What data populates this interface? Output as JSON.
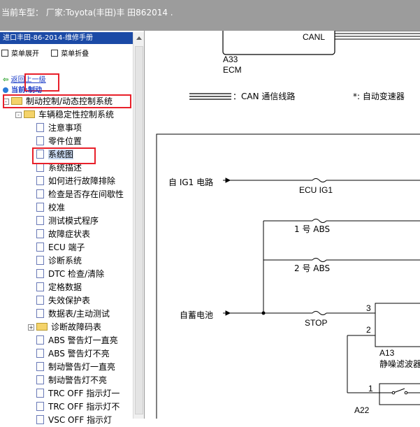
{
  "title": "当前车型： 厂家:Toyota(丰田)丰 田862014 .",
  "left_panel": {
    "header": "进口丰田-86-2014-维修手册",
    "expand_all": "菜单展开",
    "collapse_all": "菜单折叠",
    "back": "返回上一级",
    "current": "当前:制动",
    "tree": [
      {
        "label": "制动控制/动态控制系统",
        "level": 0,
        "kind": "folder",
        "pm": "-"
      },
      {
        "label": "车辆稳定性控制系统",
        "level": 1,
        "kind": "folder",
        "pm": "-"
      },
      {
        "label": "注意事项",
        "level": 2,
        "kind": "doc"
      },
      {
        "label": "零件位置",
        "level": 2,
        "kind": "doc"
      },
      {
        "label": "系统图",
        "level": 2,
        "kind": "doc"
      },
      {
        "label": "系统描述",
        "level": 2,
        "kind": "doc"
      },
      {
        "label": "如何进行故障排除",
        "level": 2,
        "kind": "doc"
      },
      {
        "label": "检查是否存在间歇性",
        "level": 2,
        "kind": "doc"
      },
      {
        "label": "校准",
        "level": 2,
        "kind": "doc"
      },
      {
        "label": "测试模式程序",
        "level": 2,
        "kind": "doc"
      },
      {
        "label": "故障症状表",
        "level": 2,
        "kind": "doc"
      },
      {
        "label": "ECU 端子",
        "level": 2,
        "kind": "doc"
      },
      {
        "label": "诊断系统",
        "level": 2,
        "kind": "doc"
      },
      {
        "label": "DTC 检查/清除",
        "level": 2,
        "kind": "doc"
      },
      {
        "label": "定格数据",
        "level": 2,
        "kind": "doc"
      },
      {
        "label": "失效保护表",
        "level": 2,
        "kind": "doc"
      },
      {
        "label": "数据表/主动测试",
        "level": 2,
        "kind": "doc"
      },
      {
        "label": "诊断故障码表",
        "level": 2,
        "kind": "folder",
        "pm": "+"
      },
      {
        "label": "ABS 警告灯一直亮",
        "level": 2,
        "kind": "doc"
      },
      {
        "label": "ABS 警告灯不亮",
        "level": 2,
        "kind": "doc"
      },
      {
        "label": "制动警告灯一直亮",
        "level": 2,
        "kind": "doc"
      },
      {
        "label": "制动警告灯不亮",
        "level": 2,
        "kind": "doc"
      },
      {
        "label": "TRC OFF 指示灯一",
        "level": 2,
        "kind": "doc"
      },
      {
        "label": "TRC OFF 指示灯不",
        "level": 2,
        "kind": "doc"
      },
      {
        "label": "VSC OFF 指示灯",
        "level": 2,
        "kind": "doc"
      }
    ]
  },
  "diagram": {
    "canl": "CANL",
    "ecm_code": "A33",
    "ecm_name": "ECM",
    "legend_can": "：CAN 通信线路",
    "legend_star": "*:  自动变速器",
    "ig1_label": "自 IG1 电路",
    "fuse_ecu": "ECU IG1",
    "fuse_abs1": "1 号 ABS",
    "fuse_abs2": "2 号 ABS",
    "battery_label": "自蓄电池",
    "fuse_stop": "STOP",
    "pin3": "3",
    "pin2": "2",
    "pin1": "1",
    "a13_code": "A13",
    "a13_name": "静噪滤波器",
    "a22_code": "A22"
  },
  "colors": {
    "titlebar": "#9c9c9c",
    "panel_header": "#1b4aa6",
    "highlight_box": "#e8202a",
    "selected_bg": "#c8d8f0"
  }
}
